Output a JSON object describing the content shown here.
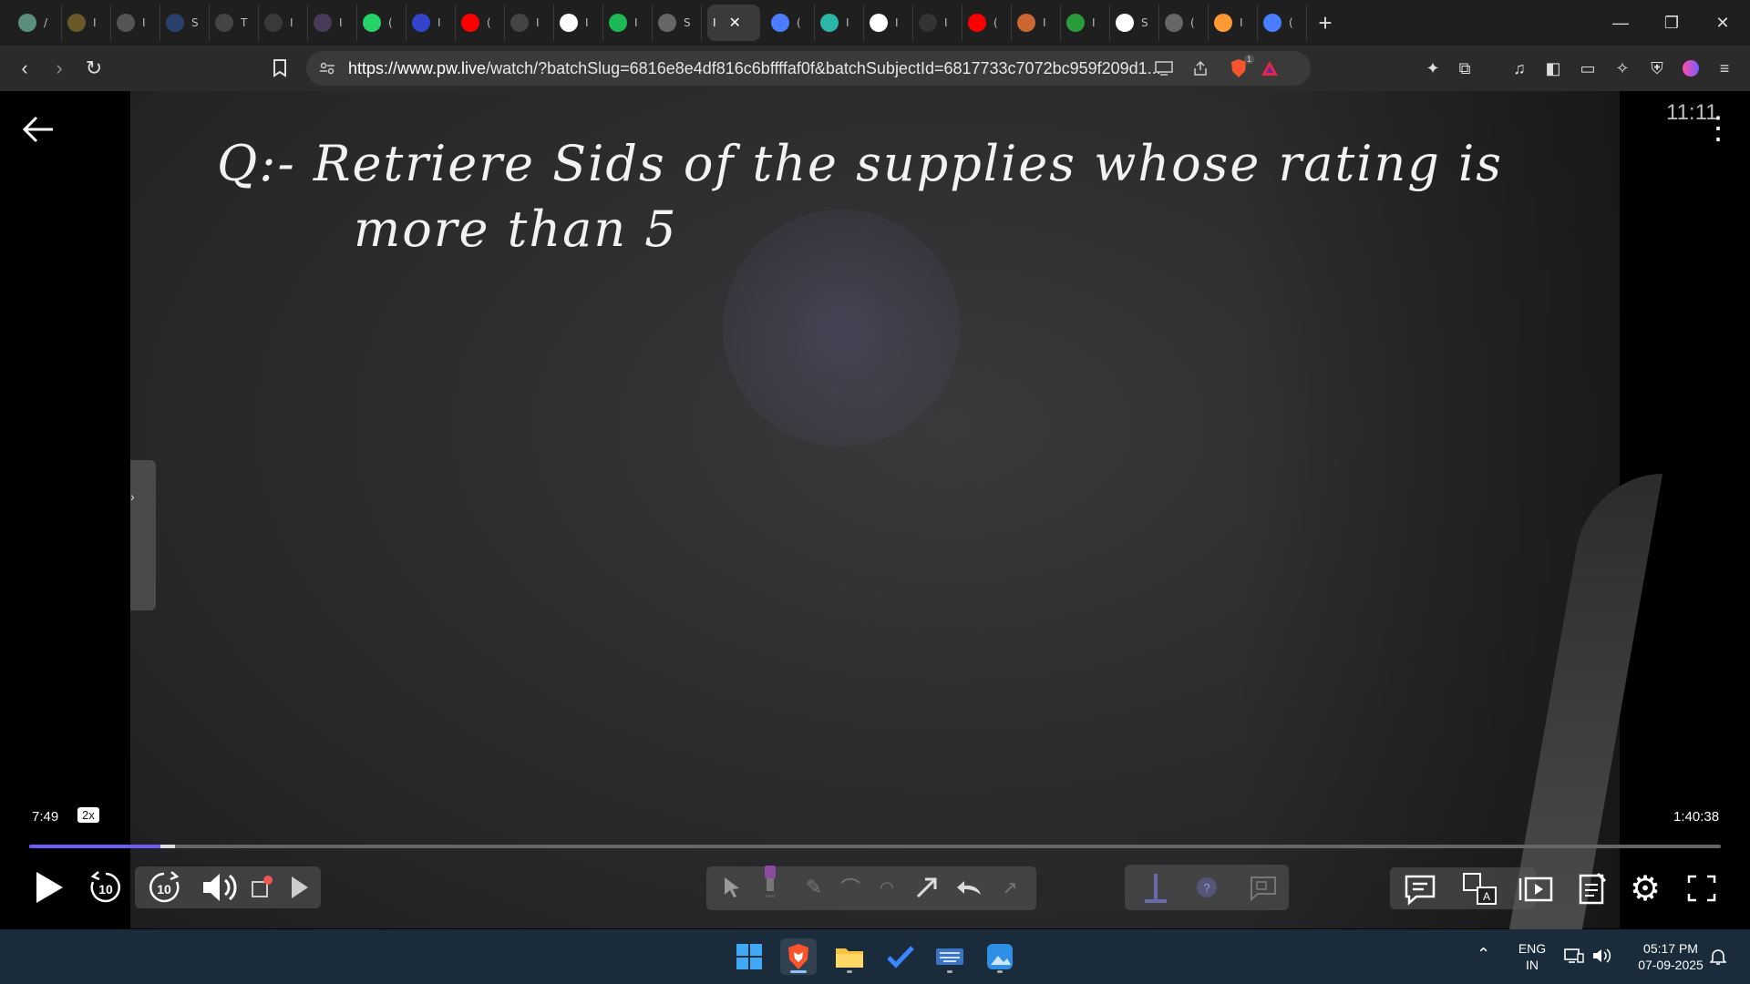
{
  "browser": {
    "tabs": [
      {
        "icon": "monitor-favicon-icon",
        "color": "#5a8f7b",
        "title": "/"
      },
      {
        "icon": "coin-favicon-icon",
        "color": "#6a5a2a",
        "title": "I"
      },
      {
        "icon": "globe-favicon-icon",
        "color": "#555555",
        "title": "I"
      },
      {
        "icon": "sql-favicon-icon",
        "color": "#2a3f6a",
        "title": "S"
      },
      {
        "icon": "w3-favicon-icon",
        "color": "#444444",
        "title": "T"
      },
      {
        "icon": "circle-favicon-icon",
        "color": "#3a3a3a",
        "title": "I"
      },
      {
        "icon": "avatar-favicon-icon",
        "color": "#4a3a5a",
        "title": "I"
      },
      {
        "icon": "whatsapp-favicon-icon",
        "color": "#25d366",
        "title": "("
      },
      {
        "icon": "flag-favicon-icon",
        "color": "#3344cc",
        "title": "I"
      },
      {
        "icon": "youtube-favicon-icon",
        "color": "#ff0000",
        "title": "("
      },
      {
        "icon": "circle-text-favicon-icon",
        "color": "#444444",
        "title": "I"
      },
      {
        "icon": "google-favicon-icon",
        "color": "#ffffff",
        "title": "I"
      },
      {
        "icon": "spotify-favicon-icon",
        "color": "#1db954",
        "title": "I"
      },
      {
        "icon": "globe-favicon-icon",
        "color": "#666666",
        "title": "S"
      }
    ],
    "active_tab": {
      "title": "I",
      "close": "✕"
    },
    "tabs_after": [
      {
        "icon": "gemini-favicon-icon",
        "color": "#4a7dff",
        "title": "("
      },
      {
        "icon": "pw-favicon-icon",
        "color": "#2bb6a8",
        "title": "I"
      },
      {
        "icon": "google-favicon-icon",
        "color": "#ffffff",
        "title": "I"
      },
      {
        "icon": "screen-favicon-icon",
        "color": "#333333",
        "title": "I"
      },
      {
        "icon": "youtube-favicon-icon",
        "color": "#ff0000",
        "title": "("
      },
      {
        "icon": "burger-favicon-icon",
        "color": "#cc6633",
        "title": "I"
      },
      {
        "icon": "chart-favicon-icon",
        "color": "#2a9d3a",
        "title": "I"
      },
      {
        "icon": "wikipedia-favicon-icon",
        "color": "#ffffff",
        "title": "S"
      },
      {
        "icon": "globe-favicon-icon",
        "color": "#666666",
        "title": "("
      },
      {
        "icon": "india-flag-favicon-icon",
        "color": "#ff9933",
        "title": "I"
      },
      {
        "icon": "gemini-favicon-icon",
        "color": "#4a7dff",
        "title": "("
      }
    ],
    "new_tab": "+",
    "url_domain": "https://www.pw.live",
    "url_rest": "/watch/?batchSlug=6816e8e4df816c6bffffaf0f&batchSubjectId=6817733c7072bc959f209d1...",
    "brave_badge": "1"
  },
  "player": {
    "board_line1": "Q:-  Retriere  Sids  of  the  supplies  whose  rating  is",
    "board_line2": "more  than  5",
    "overlay_clock": "11:11",
    "current_time": "7:49",
    "speed": "2x",
    "total_time": "1:40:38",
    "progress_fraction": 0.0777,
    "buffered_fraction": 0.086,
    "rewind_label": "10",
    "forward_label": "10"
  },
  "taskbar": {
    "lang_line1": "ENG",
    "lang_line2": "IN",
    "time": "05:17 PM",
    "date": "07-09-2025"
  }
}
